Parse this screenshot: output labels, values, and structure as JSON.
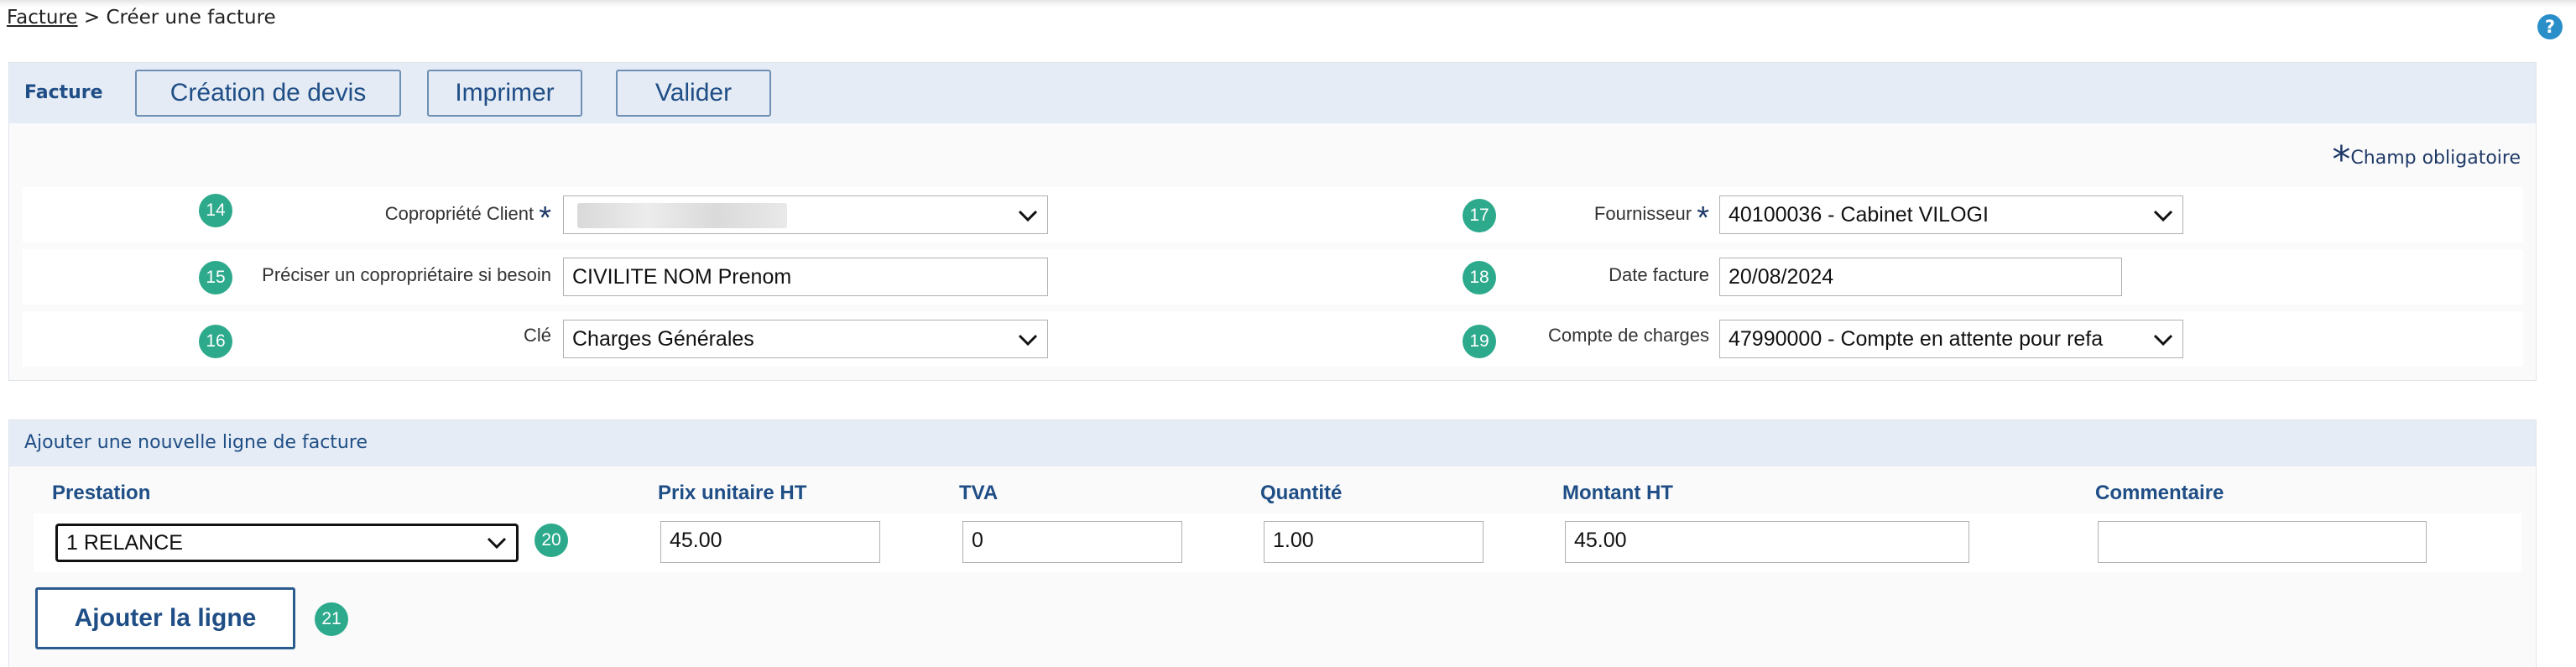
{
  "breadcrumb": {
    "parent": "Facture",
    "separator": ">",
    "current": "Créer une facture"
  },
  "help": {
    "label": "?"
  },
  "invoice_panel": {
    "title": "Facture",
    "buttons": {
      "quote": "Création de devis",
      "print": "Imprimer",
      "validate": "Valider"
    },
    "required_note": {
      "star": "*",
      "text": "Champ obligatoire"
    },
    "fields": {
      "copropriete": {
        "badge": "14",
        "label": "Copropriété Client",
        "required": "*",
        "value": ""
      },
      "coproprietaire": {
        "badge": "15",
        "label": "Préciser un copropriétaire si besoin",
        "value": "CIVILITE NOM Prenom"
      },
      "cle": {
        "badge": "16",
        "label": "Clé",
        "value": "Charges Générales"
      },
      "fournisseur": {
        "badge": "17",
        "label": "Fournisseur",
        "required": "*",
        "value": "40100036 - Cabinet VILOGI"
      },
      "date": {
        "badge": "18",
        "label": "Date facture",
        "value": "20/08/2024"
      },
      "compte": {
        "badge": "19",
        "label": "Compte de charges",
        "value": "47990000 - Compte en attente pour refa"
      }
    }
  },
  "line_panel": {
    "title": "Ajouter une nouvelle ligne de facture",
    "columns": {
      "prestation": "Prestation",
      "prix": "Prix unitaire HT",
      "tva": "TVA",
      "quantite": "Quantité",
      "montant": "Montant HT",
      "commentaire": "Commentaire"
    },
    "values": {
      "prestation": "1 RELANCE",
      "prestation_badge": "20",
      "prix": "45.00",
      "tva": "0",
      "quantite": "1.00",
      "montant": "45.00",
      "commentaire": ""
    },
    "add_button": {
      "label": "Ajouter la ligne",
      "badge": "21"
    }
  },
  "colors": {
    "accent": "#1f4e86",
    "badge": "#2daa8c",
    "header_bg": "#e5ecf5"
  }
}
